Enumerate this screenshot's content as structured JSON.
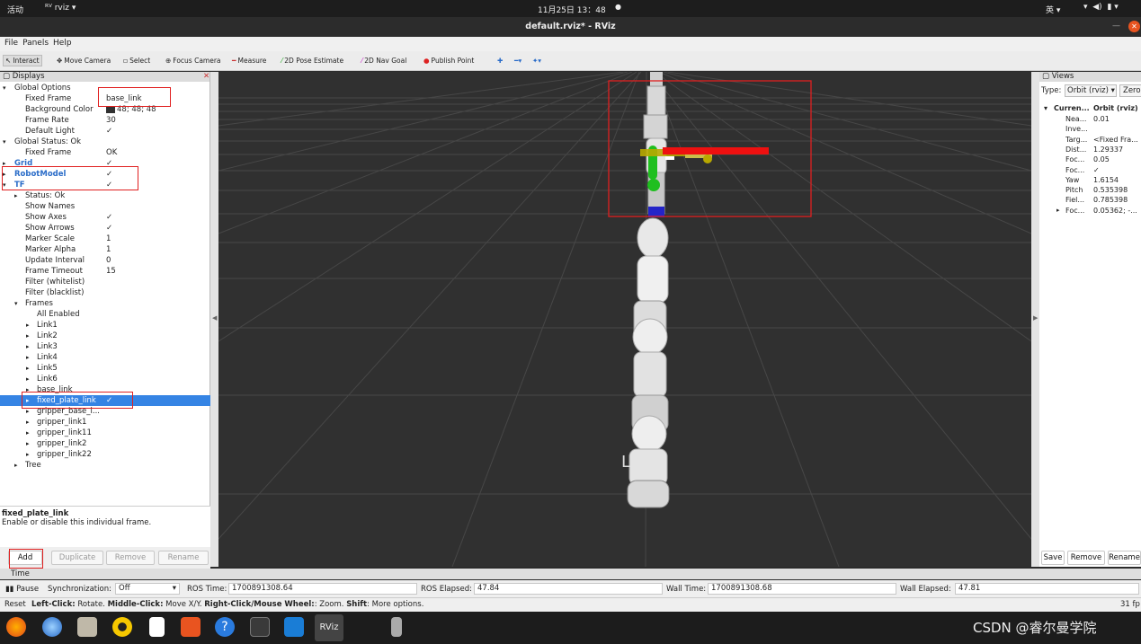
{
  "topbar": {
    "activities": "活动",
    "app": "rviz",
    "clock": "11月25日 13：48",
    "lang": "英"
  },
  "window": {
    "title": "default.rviz* - RViz"
  },
  "menu": [
    "File",
    "Panels",
    "Help"
  ],
  "toolbar": {
    "interact": "Interact",
    "move_camera": "Move Camera",
    "select": "Select",
    "focus_camera": "Focus Camera",
    "measure": "Measure",
    "pose_estimate": "2D Pose Estimate",
    "nav_goal": "2D Nav Goal",
    "publish_point": "Publish Point"
  },
  "displays": {
    "title": "Displays",
    "rows": [
      {
        "name": "Global Options",
        "value": "",
        "indent": 1,
        "arrow": "down"
      },
      {
        "name": "Fixed Frame",
        "value": "base_link",
        "indent": 2
      },
      {
        "name": "Background Color",
        "value": "48; 48; 48",
        "indent": 2,
        "swatch": "#303030"
      },
      {
        "name": "Frame Rate",
        "value": "30",
        "indent": 2
      },
      {
        "name": "Default Light",
        "value": "✓",
        "indent": 2
      },
      {
        "name": "Global Status: Ok",
        "value": "",
        "indent": 1,
        "arrow": "down"
      },
      {
        "name": "Fixed Frame",
        "value": "OK",
        "indent": 2
      },
      {
        "name": "Grid",
        "value": "✓",
        "indent": 1,
        "arrow": "right",
        "blue": true
      },
      {
        "name": "RobotModel",
        "value": "✓",
        "indent": 1,
        "arrow": "right",
        "blue": true
      },
      {
        "name": "TF",
        "value": "✓",
        "indent": 1,
        "arrow": "down",
        "blue": true
      },
      {
        "name": "Status: Ok",
        "value": "",
        "indent": 2,
        "arrow": "right"
      },
      {
        "name": "Show Names",
        "value": "",
        "indent": 2
      },
      {
        "name": "Show Axes",
        "value": "✓",
        "indent": 2
      },
      {
        "name": "Show Arrows",
        "value": "✓",
        "indent": 2
      },
      {
        "name": "Marker Scale",
        "value": "1",
        "indent": 2
      },
      {
        "name": "Marker Alpha",
        "value": "1",
        "indent": 2
      },
      {
        "name": "Update Interval",
        "value": "0",
        "indent": 2
      },
      {
        "name": "Frame Timeout",
        "value": "15",
        "indent": 2
      },
      {
        "name": "Filter (whitelist)",
        "value": "",
        "indent": 2
      },
      {
        "name": "Filter (blacklist)",
        "value": "",
        "indent": 2
      },
      {
        "name": "Frames",
        "value": "",
        "indent": 2,
        "arrow": "down"
      },
      {
        "name": "All Enabled",
        "value": "",
        "indent": 3
      },
      {
        "name": "Link1",
        "value": "",
        "indent": 3,
        "arrow": "right"
      },
      {
        "name": "Link2",
        "value": "",
        "indent": 3,
        "arrow": "right"
      },
      {
        "name": "Link3",
        "value": "",
        "indent": 3,
        "arrow": "right"
      },
      {
        "name": "Link4",
        "value": "",
        "indent": 3,
        "arrow": "right"
      },
      {
        "name": "Link5",
        "value": "",
        "indent": 3,
        "arrow": "right"
      },
      {
        "name": "Link6",
        "value": "",
        "indent": 3,
        "arrow": "right"
      },
      {
        "name": "base_link",
        "value": "",
        "indent": 3,
        "arrow": "right"
      },
      {
        "name": "fixed_plate_link",
        "value": "✓",
        "indent": 3,
        "arrow": "right",
        "selected": true
      },
      {
        "name": "gripper_base_l...",
        "value": "",
        "indent": 3,
        "arrow": "right"
      },
      {
        "name": "gripper_link1",
        "value": "",
        "indent": 3,
        "arrow": "right"
      },
      {
        "name": "gripper_link11",
        "value": "",
        "indent": 3,
        "arrow": "right"
      },
      {
        "name": "gripper_link2",
        "value": "",
        "indent": 3,
        "arrow": "right"
      },
      {
        "name": "gripper_link22",
        "value": "",
        "indent": 3,
        "arrow": "right"
      },
      {
        "name": "Tree",
        "value": "",
        "indent": 2,
        "arrow": "right"
      }
    ],
    "desc_title": "fixed_plate_link",
    "desc_text": "Enable or disable this individual frame.",
    "buttons": [
      "Add",
      "Duplicate",
      "Remove",
      "Rename"
    ]
  },
  "views": {
    "title": "Views",
    "type_label": "Type:",
    "type_value": "Orbit (rviz)",
    "zero": "Zero",
    "current_label": "Curren...",
    "current_value": "Orbit (rviz)",
    "rows": [
      {
        "name": "Nea...",
        "value": "0.01"
      },
      {
        "name": "Inve...",
        "value": ""
      },
      {
        "name": "Targ...",
        "value": "<Fixed Fra..."
      },
      {
        "name": "Dist...",
        "value": "1.29337"
      },
      {
        "name": "Foc...",
        "value": "0.05"
      },
      {
        "name": "Foc...",
        "value": "✓"
      },
      {
        "name": "Yaw",
        "value": "1.6154"
      },
      {
        "name": "Pitch",
        "value": "0.535398"
      },
      {
        "name": "Fiel...",
        "value": "0.785398"
      },
      {
        "name": "Foc...",
        "value": "0.05362; -..."
      }
    ],
    "buttons": [
      "Save",
      "Remove",
      "Rename"
    ]
  },
  "time": {
    "title": "Time",
    "pause": "Pause",
    "sync_label": "Synchronization:",
    "sync_value": "Off",
    "ros_time_label": "ROS Time:",
    "ros_time": "1700891308.64",
    "ros_elapsed_label": "ROS Elapsed:",
    "ros_elapsed": "47.84",
    "wall_time_label": "Wall Time:",
    "wall_time": "1700891308.68",
    "wall_elapsed_label": "Wall Elapsed:",
    "wall_elapsed": "47.81"
  },
  "status": {
    "reset": "Reset",
    "hint_b1": "Left-Click:",
    "hint_t1": " Rotate. ",
    "hint_b2": "Middle-Click:",
    "hint_t2": " Move X/Y. ",
    "hint_b3": "Right-Click/Mouse Wheel:",
    "hint_t3": ": Zoom. ",
    "hint_b4": "Shift",
    "hint_t4": ": More options.",
    "fps": "31 fp"
  },
  "watermark": "CSDN @睿尔曼学院",
  "viewport": {
    "label_L": "L"
  },
  "colors": {
    "selection": "#3584e4",
    "highlight_box": "#e02020",
    "viewport_bg": "#303030"
  }
}
